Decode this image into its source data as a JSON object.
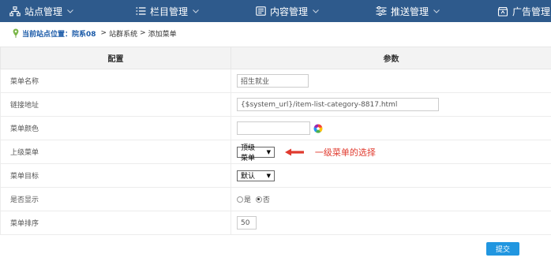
{
  "nav": {
    "items": [
      {
        "label": "站点管理",
        "icon": "sitemap-icon"
      },
      {
        "label": "栏目管理",
        "icon": "list-icon"
      },
      {
        "label": "内容管理",
        "icon": "document-icon"
      },
      {
        "label": "推送管理",
        "icon": "sliders-icon"
      },
      {
        "label": "广告管理",
        "icon": "ad-icon"
      }
    ]
  },
  "breadcrumb": {
    "icon": "location-pin-icon",
    "current_label": "当前站点位置：",
    "site": "院系08",
    "sep": ">",
    "section": "站群系统",
    "page": "添加菜单"
  },
  "table": {
    "headers": {
      "config": "配置",
      "params": "参数"
    },
    "rows": {
      "menu_name": {
        "label": "菜单名称",
        "value": "招生就业"
      },
      "link_url": {
        "label": "链接地址",
        "value": "{$system_url}/item-list-category-8817.html"
      },
      "menu_color": {
        "label": "菜单颜色",
        "value": ""
      },
      "parent_menu": {
        "label": "上级菜单",
        "selected": "顶级菜单",
        "annotation": "一级菜单的选择"
      },
      "menu_target": {
        "label": "菜单目标",
        "selected": "默认"
      },
      "visible": {
        "label": "是否显示",
        "option_yes": "是",
        "option_no": "否",
        "selected": "否"
      },
      "sort_order": {
        "label": "菜单排序",
        "value": "50"
      }
    }
  },
  "actions": {
    "submit_label": "提交"
  },
  "colors": {
    "nav_bg": "#2e5a8c",
    "accent": "#2196e0",
    "annotation": "#e03a2e"
  }
}
